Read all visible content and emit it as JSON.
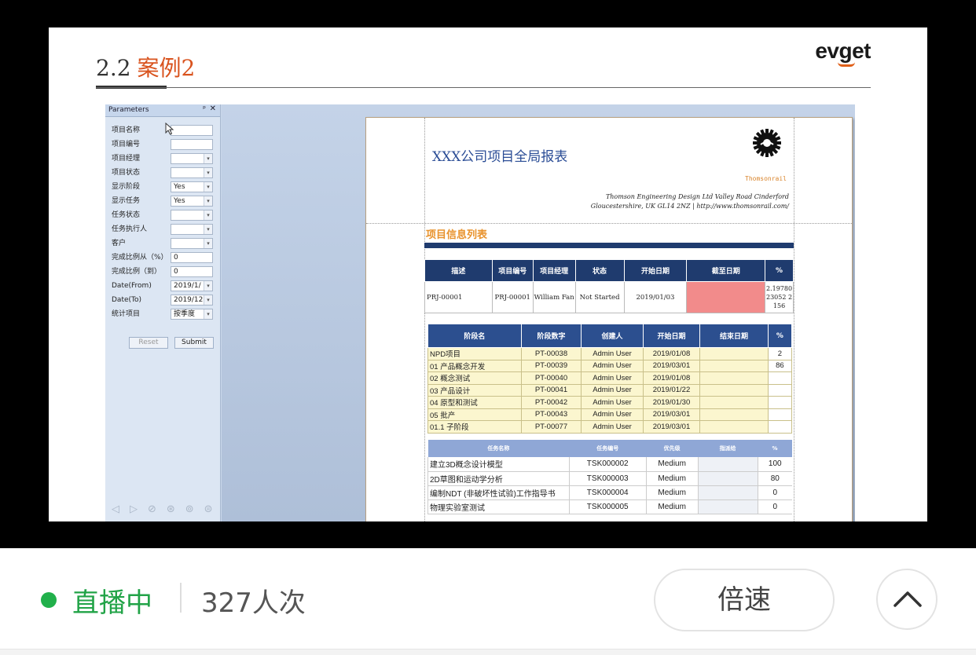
{
  "slide": {
    "section_number": "2.2",
    "section_title": "案例2",
    "logo_text": "evget"
  },
  "params_panel": {
    "title": "Parameters",
    "fields": [
      {
        "label": "项目名称",
        "value": "",
        "type": "text"
      },
      {
        "label": "项目编号",
        "value": "",
        "type": "text"
      },
      {
        "label": "项目经理",
        "value": "",
        "type": "select"
      },
      {
        "label": "项目状态",
        "value": "",
        "type": "select"
      },
      {
        "label": "显示阶段",
        "value": "Yes",
        "type": "select"
      },
      {
        "label": "显示任务",
        "value": "Yes",
        "type": "select"
      },
      {
        "label": "任务状态",
        "value": "",
        "type": "select"
      },
      {
        "label": "任务执行人",
        "value": "",
        "type": "select"
      },
      {
        "label": "客户",
        "value": "",
        "type": "select"
      },
      {
        "label": "完成比例从（%）",
        "value": "0",
        "type": "text"
      },
      {
        "label": "完成比例（到）",
        "value": "0",
        "type": "text"
      },
      {
        "label": "Date(From)",
        "value": "2019/1/",
        "type": "select"
      },
      {
        "label": "Date(To)",
        "value": "2019/12",
        "type": "select"
      },
      {
        "label": "统计项目",
        "value": "按季度",
        "type": "select"
      }
    ],
    "reset_label": "Reset",
    "submit_label": "Submit"
  },
  "report": {
    "title": "XXX公司项目全局报表",
    "brand": "Thomsonrail",
    "address_line1": "Thomson Engineering Design Ltd Valley Road Cinderford",
    "address_line2": "Gloucestershire, UK GL14 2NZ | http://www.thomsonrail.com/",
    "section_title": "项目信息列表",
    "project_table": {
      "headers": [
        "描述",
        "项目编号",
        "项目经理",
        "状态",
        "开始日期",
        "截至日期",
        "%"
      ],
      "row": [
        "PRJ-00001",
        "PRJ-00001",
        "William Fan",
        "Not Started",
        "2019/01/03",
        "",
        "2.1978023052 2156"
      ],
      "highlight_color": "#f28b8b"
    },
    "phase_table": {
      "headers": [
        "阶段名",
        "阶段数字",
        "创建人",
        "开始日期",
        "结束日期",
        "%"
      ],
      "rows": [
        [
          "NPD项目",
          "PT-00038",
          "Admin User",
          "2019/01/08",
          "",
          "2"
        ],
        [
          "01 产品概念开发",
          "PT-00039",
          "Admin User",
          "2019/03/01",
          "",
          "86"
        ],
        [
          "02 概念测试",
          "PT-00040",
          "Admin User",
          "2019/01/08",
          "",
          ""
        ],
        [
          "03 产品设计",
          "PT-00041",
          "Admin User",
          "2019/01/22",
          "",
          ""
        ],
        [
          "04 原型和测试",
          "PT-00042",
          "Admin User",
          "2019/01/30",
          "",
          ""
        ],
        [
          "05 批产",
          "PT-00043",
          "Admin User",
          "2019/03/01",
          "",
          ""
        ],
        [
          "01.1 子阶段",
          "PT-00077",
          "Admin User",
          "2019/03/01",
          "",
          ""
        ]
      ]
    },
    "task_table": {
      "headers": [
        "任务名称",
        "任务编号",
        "优先级",
        "指派给",
        "%"
      ],
      "rows": [
        [
          "建立3D概念设计模型",
          "TSK000002",
          "Medium",
          "",
          "100"
        ],
        [
          "2D草图和运动学分析",
          "TSK000003",
          "Medium",
          "",
          "80"
        ],
        [
          "编制NDT (非破坏性试验)工作指导书",
          "TSK000004",
          "Medium",
          "",
          "0"
        ],
        [
          "物理实验室测试",
          "TSK000005",
          "Medium",
          "",
          "0"
        ]
      ]
    }
  },
  "footer": {
    "live_label": "直播中",
    "viewers": "327人次",
    "speed_label": "倍速"
  }
}
